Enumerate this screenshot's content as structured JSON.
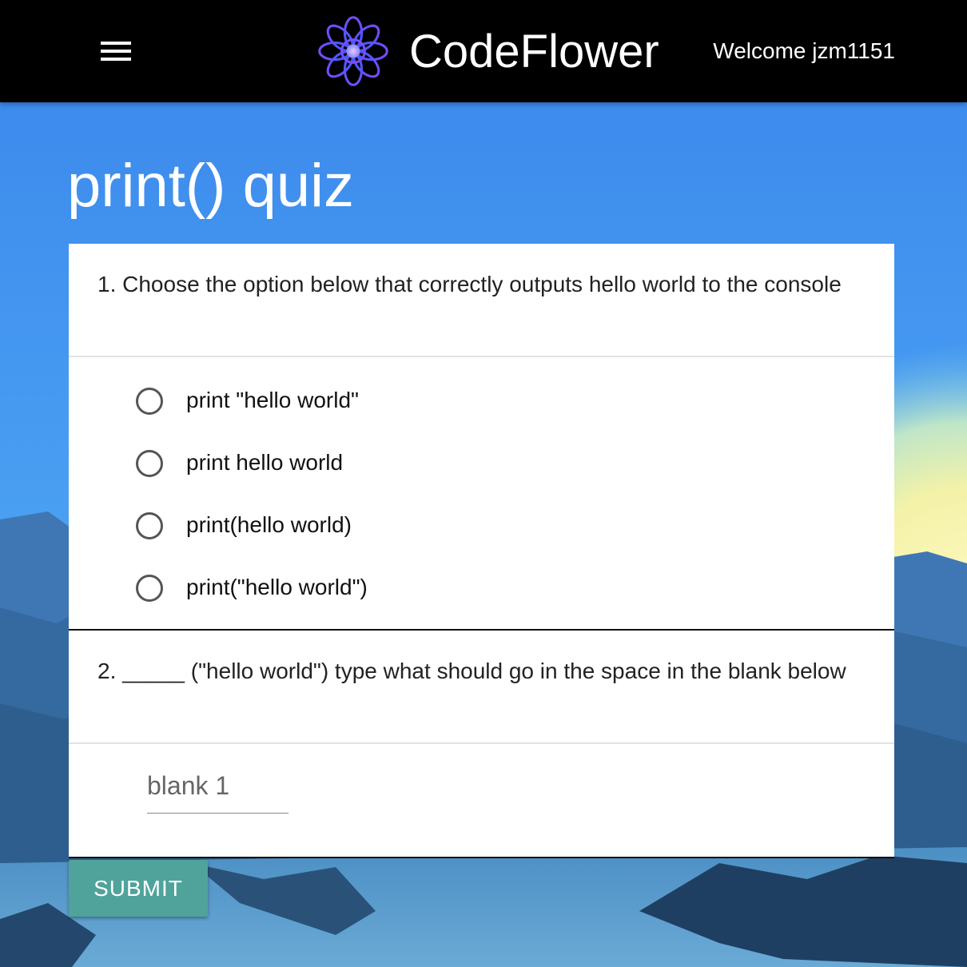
{
  "header": {
    "brand": "CodeFlower",
    "welcome": "Welcome jzm1151",
    "menu_icon": "hamburger-menu-icon",
    "logo_icon": "flower-logo-icon"
  },
  "page": {
    "title": "print() quiz"
  },
  "questions": [
    {
      "number": "1.",
      "text": "Choose the option below that correctly outputs hello world to the console",
      "type": "multiple-choice",
      "options": [
        "print \"hello world\"",
        "print hello world",
        "print(hello world)",
        "print(\"hello world\")"
      ]
    },
    {
      "number": "2.",
      "text": "_____ (\"hello world\")  type what should go in the space in the blank below",
      "type": "fill-in",
      "input_value": "",
      "input_placeholder": "blank 1"
    }
  ],
  "submit": {
    "label": "SUBMIT"
  },
  "colors": {
    "topbar": "#000000",
    "submit_button": "#4fa39b",
    "sky_top": "#3b8cee",
    "mountains": "#2b5f8f",
    "logo_purple": "#a238ff",
    "logo_blue": "#3a5cff"
  }
}
